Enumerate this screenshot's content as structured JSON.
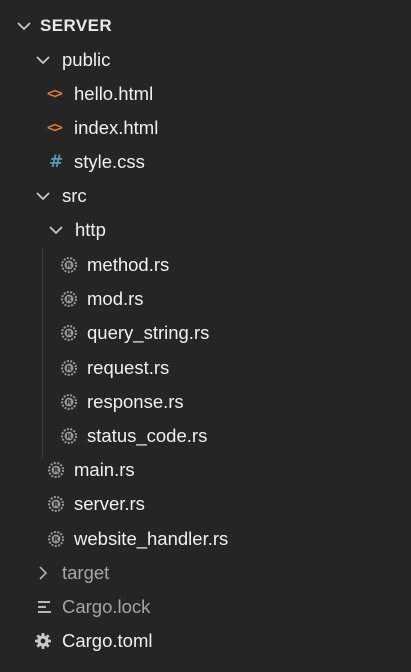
{
  "explorer": {
    "section_title": "SERVER",
    "items": [
      {
        "label": "public"
      },
      {
        "label": "hello.html"
      },
      {
        "label": "index.html"
      },
      {
        "label": "style.css"
      },
      {
        "label": "src"
      },
      {
        "label": "http"
      },
      {
        "label": "method.rs"
      },
      {
        "label": "mod.rs"
      },
      {
        "label": "query_string.rs"
      },
      {
        "label": "request.rs"
      },
      {
        "label": "response.rs"
      },
      {
        "label": "status_code.rs"
      },
      {
        "label": "main.rs"
      },
      {
        "label": "server.rs"
      },
      {
        "label": "website_handler.rs"
      },
      {
        "label": "target"
      },
      {
        "label": "Cargo.lock"
      },
      {
        "label": "Cargo.toml"
      }
    ]
  },
  "icons": {
    "folder_open": "chevron-down-icon",
    "folder_closed": "chevron-right-icon",
    "html": "html-file-icon",
    "css": "css-file-icon",
    "rust": "rust-file-icon",
    "lock": "lines-file-icon",
    "toml": "gear-icon"
  },
  "colors": {
    "background": "#252526",
    "text": "#f0f0f0",
    "text_dim": "#a5a5a5",
    "html_icon": "#e37933",
    "css_icon": "#519aba",
    "rust_icon": "#9a9a9a"
  }
}
